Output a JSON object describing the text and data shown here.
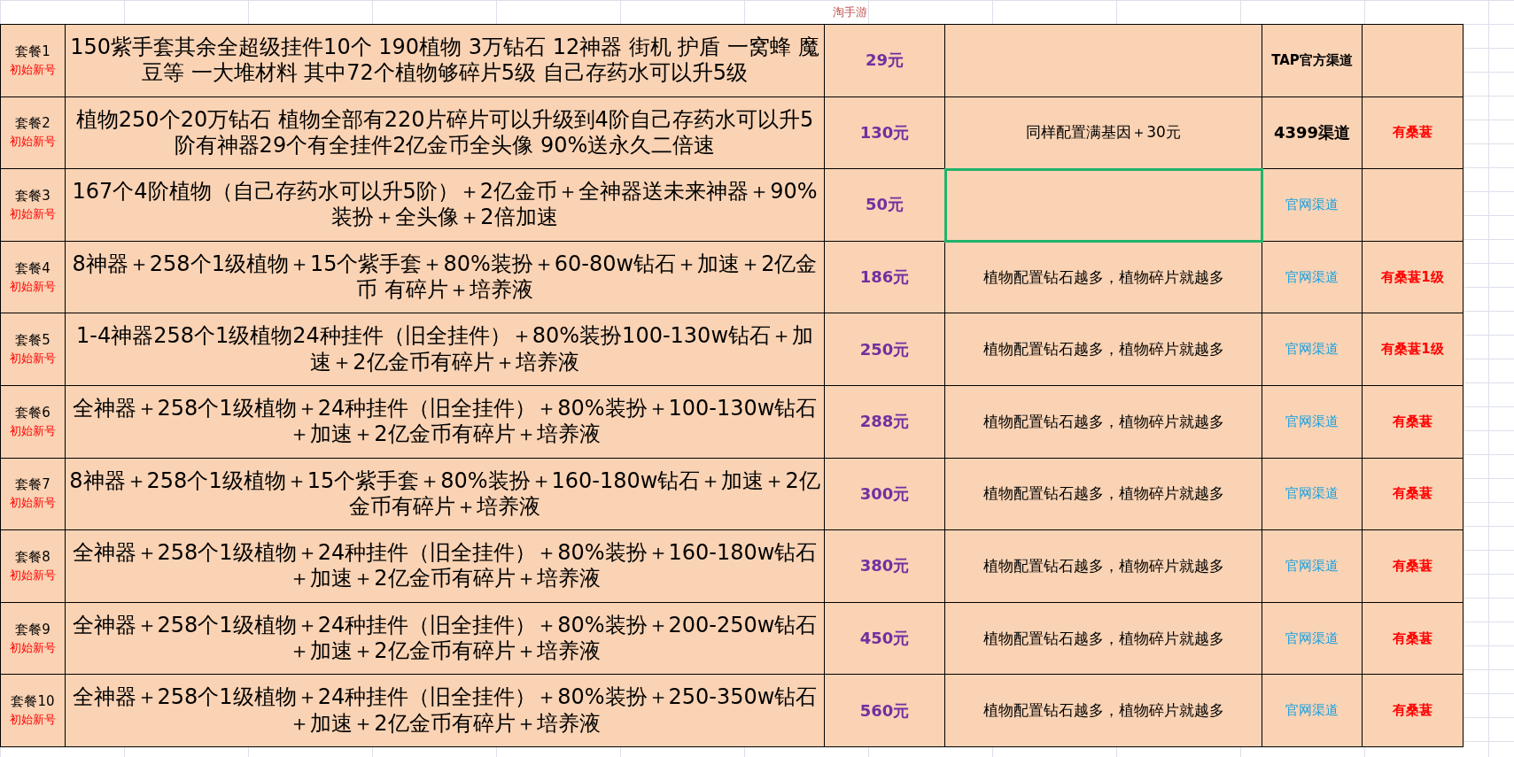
{
  "sheet_title": "淘手游",
  "rows": [
    {
      "package": "套餐1",
      "tag": "初始新号",
      "content": "150紫手套其余全超级挂件10个 190植物  3万钻石  12神器  街机  护盾  一窝蜂  魔豆等  一大堆材料  其中72个植物够碎片5级  自己存药水可以升5级",
      "price": "29元",
      "note_selected": false,
      "channel": "TAP官方渠道",
      "kind": "bold"
    },
    {
      "package": "套餐2",
      "tag": "初始新号",
      "content": "植物250个20万钻石  植物全部有220片碎片可以升级到4阶自己存药水可以升5阶有神器29个有全挂件2亿金币全头像 90%送永久二倍速",
      "price": "130元",
      "note": "同样配置满基因＋30元",
      "note_selected": false,
      "channel": "4399渠道",
      "kind": "large",
      "badge": "有桑葚"
    },
    {
      "package": "套餐3",
      "tag": "初始新号",
      "content": "167个4阶植物（自己存药水可以升5阶）＋2亿金币＋全神器送未来神器＋90%装扮＋全头像＋2倍加速",
      "price": "50元",
      "note_selected": true,
      "channel": "官网渠道",
      "kind": "link"
    },
    {
      "package": "套餐4",
      "tag": "初始新号",
      "content": "8神器＋258个1级植物＋15个紫手套＋80%装扮＋60-80w钻石＋加速＋2亿金币 有碎片＋培养液",
      "price": "186元",
      "note": "植物配置钻石越多，植物碎片就越多",
      "note_selected": false,
      "channel": "官网渠道",
      "kind": "link",
      "badge": "有桑葚1级"
    },
    {
      "package": "套餐5",
      "tag": "初始新号",
      "content": "1-4神器258个1级植物24种挂件（旧全挂件）＋80%装扮100-130w钻石＋加速＋2亿金币有碎片＋培养液",
      "price": "250元",
      "note": "植物配置钻石越多，植物碎片就越多",
      "note_selected": false,
      "channel": "官网渠道",
      "kind": "link",
      "badge": "有桑葚1级"
    },
    {
      "package": "套餐6",
      "tag": "初始新号",
      "content": "全神器＋258个1级植物＋24种挂件（旧全挂件）＋80%装扮＋100-130w钻石＋加速＋2亿金币有碎片＋培养液",
      "price": "288元",
      "note": "植物配置钻石越多，植物碎片就越多",
      "note_selected": false,
      "channel": "官网渠道",
      "kind": "link",
      "badge": "有桑葚"
    },
    {
      "package": "套餐7",
      "tag": "初始新号",
      "content": "8神器＋258个1级植物＋15个紫手套＋80%装扮＋160-180w钻石＋加速＋2亿金币有碎片＋培养液",
      "price": "300元",
      "note": "植物配置钻石越多，植物碎片就越多",
      "note_selected": false,
      "channel": "官网渠道",
      "kind": "link",
      "badge": "有桑葚"
    },
    {
      "package": "套餐8",
      "tag": "初始新号",
      "content": "全神器＋258个1级植物＋24种挂件（旧全挂件）＋80%装扮＋160-180w钻石＋加速＋2亿金币有碎片＋培养液",
      "price": "380元",
      "note": "植物配置钻石越多，植物碎片就越多",
      "note_selected": false,
      "channel": "官网渠道",
      "kind": "link",
      "badge": "有桑葚"
    },
    {
      "package": "套餐9",
      "tag": "初始新号",
      "content": "全神器＋258个1级植物＋24种挂件（旧全挂件）＋80%装扮＋200-250w钻石＋加速＋2亿金币有碎片＋培养液",
      "price": "450元",
      "note": "植物配置钻石越多，植物碎片就越多",
      "note_selected": false,
      "channel": "官网渠道",
      "kind": "link",
      "badge": "有桑葚"
    },
    {
      "package": "套餐10",
      "tag": "初始新号",
      "content": "全神器＋258个1级植物＋24种挂件（旧全挂件）＋80%装扮＋250-350w钻石＋加速＋2亿金币有碎片＋培养液",
      "price": "560元",
      "note": "植物配置钻石越多，植物碎片就越多",
      "note_selected": false,
      "channel": "官网渠道",
      "kind": "link",
      "badge": "有桑葚"
    }
  ]
}
